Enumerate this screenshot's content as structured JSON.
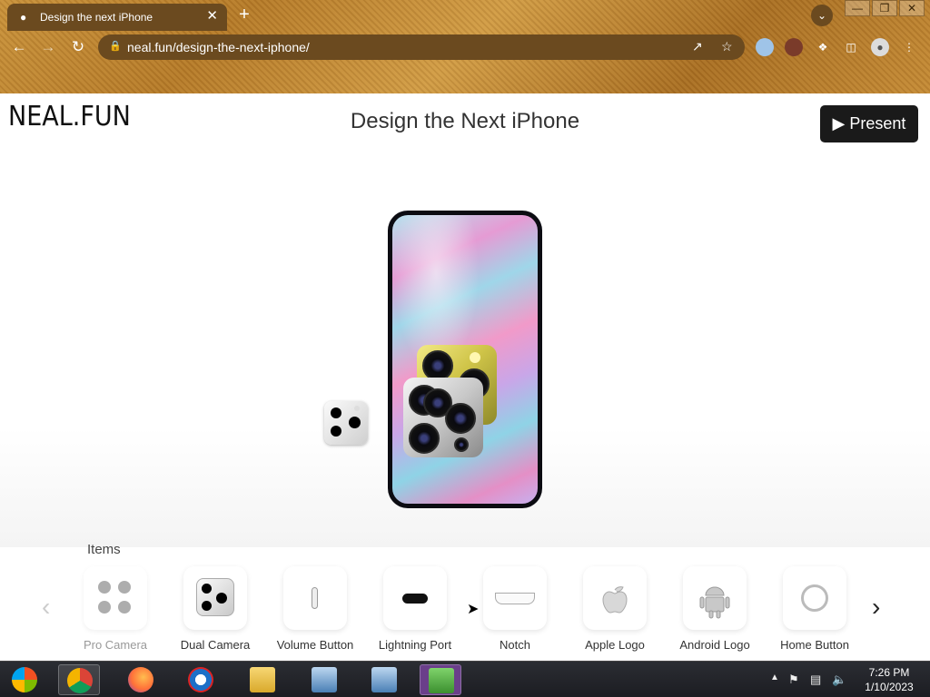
{
  "browser": {
    "tab_title": "Design the next iPhone",
    "tab_favicon": "neal-fun-icon",
    "tab_close": "✕",
    "new_tab": "+",
    "url": "neal.fun/design-the-next-iphone/",
    "window_buttons": [
      "—",
      "❐",
      "✕"
    ]
  },
  "header": {
    "logo": "NEAL.FUN",
    "title": "Design the Next iPhone",
    "present_label": "▶ Present"
  },
  "items": {
    "label": "Items",
    "list": [
      {
        "label": "Pro Camera",
        "icon": "pro-camera-icon"
      },
      {
        "label": "Dual Camera",
        "icon": "dual-camera-icon"
      },
      {
        "label": "Volume Button",
        "icon": "volume-button-icon"
      },
      {
        "label": "Lightning Port",
        "icon": "lightning-port-icon"
      },
      {
        "label": "Notch",
        "icon": "notch-icon"
      },
      {
        "label": "Apple Logo",
        "icon": "apple-logo-icon"
      },
      {
        "label": "Android Logo",
        "icon": "android-logo-icon"
      },
      {
        "label": "Home Button",
        "icon": "home-button-icon"
      }
    ],
    "prev_arrow": "‹",
    "next_arrow": "›"
  },
  "taskbar": {
    "time": "7:26 PM",
    "date": "1/10/2023"
  }
}
